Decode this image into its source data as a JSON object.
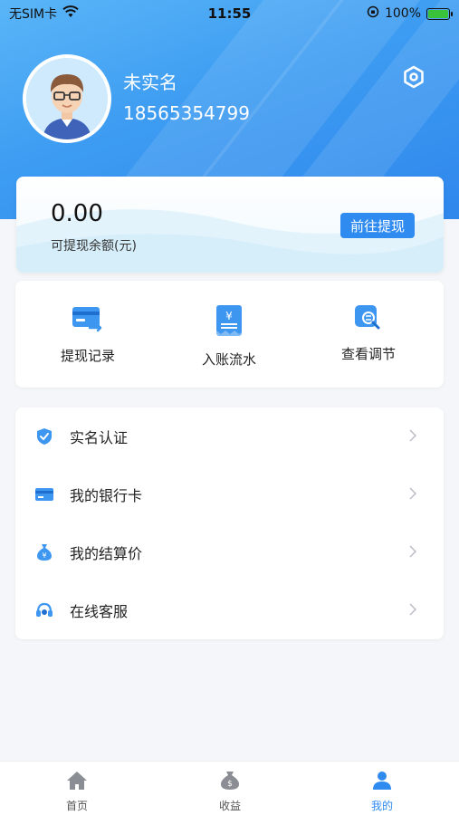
{
  "status_bar": {
    "carrier": "无SIM卡",
    "time": "11:55",
    "battery_percent": "100%"
  },
  "profile": {
    "name": "未实名",
    "phone": "18565354799"
  },
  "balance": {
    "amount": "0.00",
    "label": "可提现余额(元)",
    "withdraw_button": "前往提现"
  },
  "quick_actions": [
    {
      "label": "提现记录",
      "icon": "card-transfer-icon"
    },
    {
      "label": "入账流水",
      "icon": "receipt-icon"
    },
    {
      "label": "查看调节",
      "icon": "search-adjust-icon"
    }
  ],
  "menu": [
    {
      "label": "实名认证",
      "icon": "shield-check-icon"
    },
    {
      "label": "我的银行卡",
      "icon": "bank-card-icon"
    },
    {
      "label": "我的结算价",
      "icon": "money-bag-icon"
    },
    {
      "label": "在线客服",
      "icon": "headset-icon"
    }
  ],
  "tabs": [
    {
      "label": "首页",
      "icon": "home-icon",
      "active": false
    },
    {
      "label": "收益",
      "icon": "money-bag-icon",
      "active": false
    },
    {
      "label": "我的",
      "icon": "user-icon",
      "active": true
    }
  ],
  "colors": {
    "primary": "#2f8bef",
    "header_gradient_start": "#5ab5f7",
    "header_gradient_end": "#2f87ec",
    "page_background": "#f4f6f9"
  }
}
